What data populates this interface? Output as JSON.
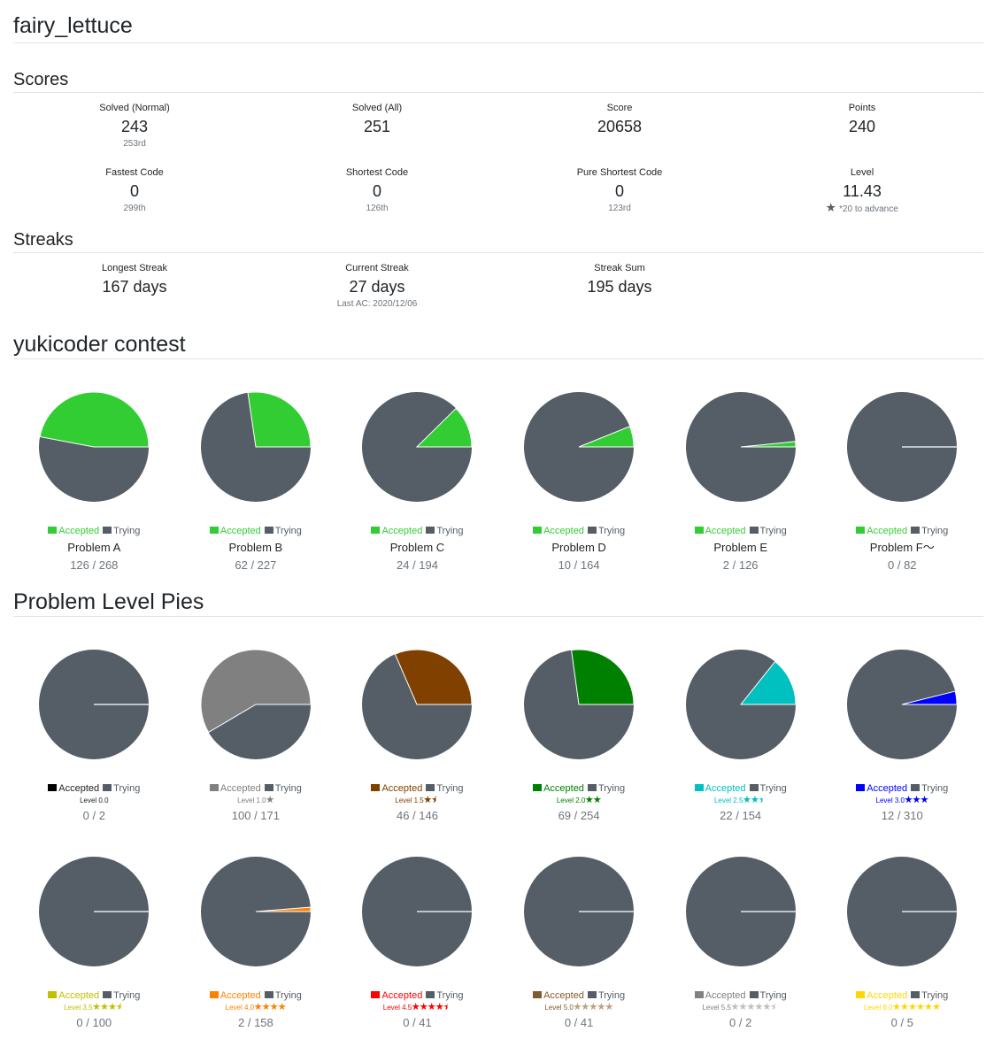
{
  "user": {
    "name": "fairy_lettuce"
  },
  "scores": {
    "title": "Scores",
    "items": [
      {
        "label": "Solved (Normal)",
        "value": "243",
        "sub": "253rd"
      },
      {
        "label": "Solved (All)",
        "value": "251",
        "sub": ""
      },
      {
        "label": "Score",
        "value": "20658",
        "sub": ""
      },
      {
        "label": "Points",
        "value": "240",
        "sub": ""
      },
      {
        "label": "Fastest Code",
        "value": "0",
        "sub": "299th"
      },
      {
        "label": "Shortest Code",
        "value": "0",
        "sub": "126th"
      },
      {
        "label": "Pure Shortest Code",
        "value": "0",
        "sub": "123rd"
      },
      {
        "label": "Level",
        "value": "11.43",
        "sub": "*20 to advance",
        "icon": "star-icon"
      }
    ]
  },
  "streaks": {
    "title": "Streaks",
    "items": [
      {
        "label": "Longest Streak",
        "value": "167 days",
        "sub": ""
      },
      {
        "label": "Current Streak",
        "value": "27 days",
        "sub": "Last AC: 2020/12/06"
      },
      {
        "label": "Streak Sum",
        "value": "195 days",
        "sub": ""
      }
    ]
  },
  "contest": {
    "title": "yukicoder contest",
    "accepted_label": "Accepted",
    "trying_label": "Trying",
    "trying_color": "#555d66",
    "problems": [
      {
        "name": "Problem A",
        "count": "126 / 268",
        "accepted": 126,
        "total": 268,
        "color": "#32cd32"
      },
      {
        "name": "Problem B",
        "count": "62 / 227",
        "accepted": 62,
        "total": 227,
        "color": "#32cd32"
      },
      {
        "name": "Problem C",
        "count": "24 / 194",
        "accepted": 24,
        "total": 194,
        "color": "#32cd32"
      },
      {
        "name": "Problem D",
        "count": "10 / 164",
        "accepted": 10,
        "total": 164,
        "color": "#32cd32"
      },
      {
        "name": "Problem E",
        "count": "2 / 126",
        "accepted": 2,
        "total": 126,
        "color": "#32cd32"
      },
      {
        "name": "Problem F～",
        "count": "0 / 82",
        "accepted": 0,
        "total": 82,
        "color": "#32cd32"
      }
    ]
  },
  "levels": {
    "title": "Problem Level Pies",
    "accepted_label": "Accepted",
    "trying_label": "Trying",
    "rows": [
      [
        {
          "level": "Level 0.0",
          "stars": 0,
          "half": false,
          "count": "0 / 2",
          "accepted": 0,
          "total": 2,
          "color": "#000000",
          "legend_color": "#000000",
          "star_color": "#000000"
        },
        {
          "level": "Level 1.0",
          "stars": 1,
          "half": false,
          "count": "100 / 171",
          "accepted": 100,
          "total": 171,
          "color": "#808080",
          "legend_color": "#808080",
          "star_color": "#808080"
        },
        {
          "level": "Level 1.5",
          "stars": 1,
          "half": true,
          "count": "46 / 146",
          "accepted": 46,
          "total": 146,
          "color": "#804000",
          "legend_color": "#804000",
          "star_color": "#804000"
        },
        {
          "level": "Level 2.0",
          "stars": 2,
          "half": false,
          "count": "69 / 254",
          "accepted": 69,
          "total": 254,
          "color": "#008000",
          "legend_color": "#008000",
          "star_color": "#008000"
        },
        {
          "level": "Level 2.5",
          "stars": 2,
          "half": true,
          "count": "22 / 154",
          "accepted": 22,
          "total": 154,
          "color": "#00c0c0",
          "legend_color": "#00c0c0",
          "star_color": "#00c0c0"
        },
        {
          "level": "Level 3.0",
          "stars": 3,
          "half": false,
          "count": "12 / 310",
          "accepted": 12,
          "total": 310,
          "color": "#0000ff",
          "legend_color": "#0000ff",
          "star_color": "#0000ff"
        }
      ],
      [
        {
          "level": "Level 3.5",
          "stars": 3,
          "half": true,
          "count": "0 / 100",
          "accepted": 0,
          "total": 100,
          "color": "#c0c000",
          "legend_color": "#c0c000",
          "star_color": "#c0c000"
        },
        {
          "level": "Level 4.0",
          "stars": 4,
          "half": false,
          "count": "2 / 158",
          "accepted": 2,
          "total": 158,
          "color": "#ff8000",
          "legend_color": "#ff8000",
          "star_color": "#ff8000"
        },
        {
          "level": "Level 4.5",
          "stars": 4,
          "half": true,
          "count": "0 / 41",
          "accepted": 0,
          "total": 41,
          "color": "#ff0000",
          "legend_color": "#ff0000",
          "star_color": "#ff0000"
        },
        {
          "level": "Level 5.0",
          "stars": 5,
          "half": false,
          "count": "0 / 41",
          "accepted": 0,
          "total": 41,
          "color": "#805a30",
          "legend_color": "#805a30",
          "star_color": "#c0a080"
        },
        {
          "level": "Level 5.5",
          "stars": 5,
          "half": true,
          "count": "0 / 2",
          "accepted": 0,
          "total": 2,
          "color": "#808080",
          "legend_color": "#808080",
          "star_color": "#c0c0c0"
        },
        {
          "level": "Level 6.0",
          "stars": 6,
          "half": false,
          "count": "0 / 5",
          "accepted": 0,
          "total": 5,
          "color": "#ffd700",
          "legend_color": "#ffd700",
          "star_color": "#ffd700"
        }
      ]
    ]
  }
}
